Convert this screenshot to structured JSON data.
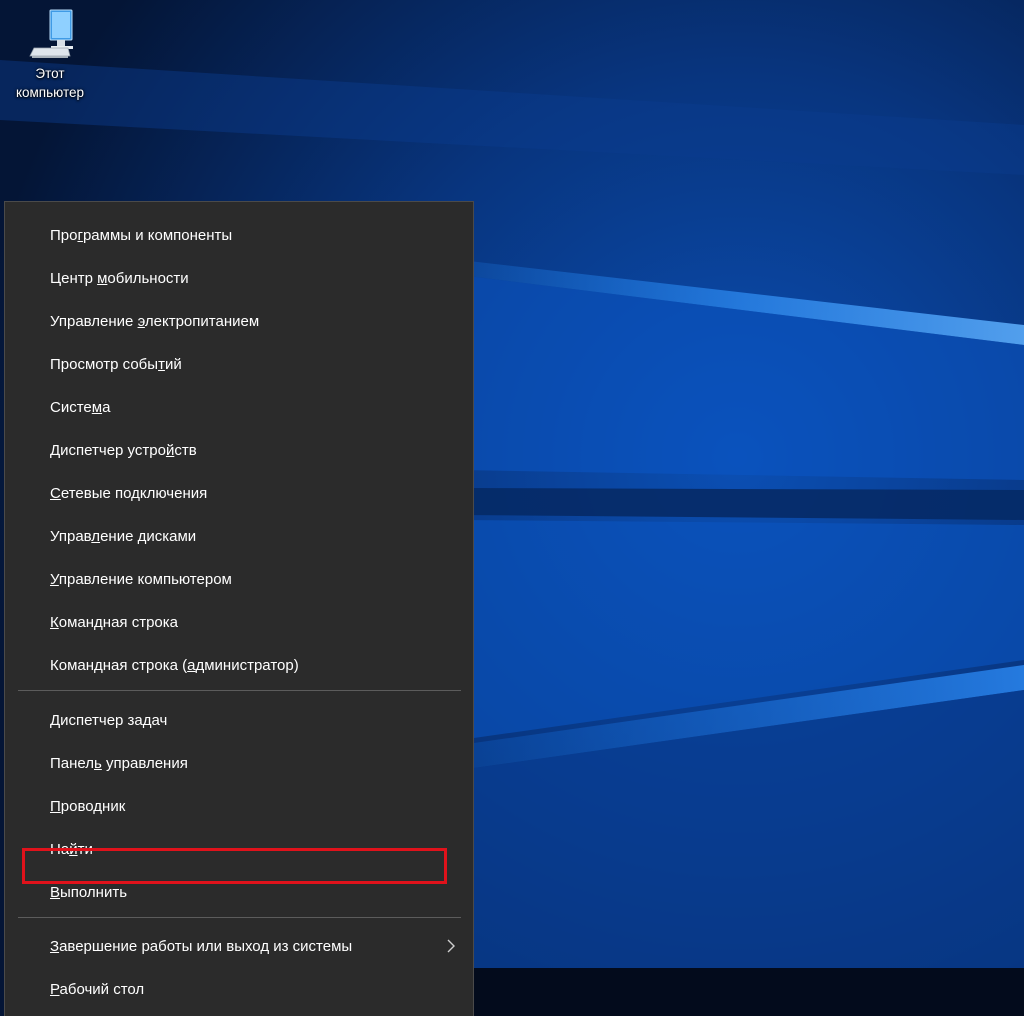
{
  "desktop": {
    "icons": [
      {
        "label_line1": "Этот",
        "label_line2": "компьютер",
        "icon": "computer-icon"
      }
    ]
  },
  "menu": {
    "items": [
      {
        "id": "programs-features",
        "pre": "Про",
        "ak": "г",
        "post": "раммы и компоненты"
      },
      {
        "id": "mobility-center",
        "pre": "Центр ",
        "ak": "м",
        "post": "обильности"
      },
      {
        "id": "power-options",
        "pre": "Управление ",
        "ak": "э",
        "post": "лектропитанием"
      },
      {
        "id": "event-viewer",
        "pre": "Просмотр собы",
        "ak": "т",
        "post": "ий"
      },
      {
        "id": "system",
        "pre": "Систе",
        "ak": "м",
        "post": "а"
      },
      {
        "id": "device-manager",
        "pre": "Диспетчер устро",
        "ak": "й",
        "post": "ств"
      },
      {
        "id": "network-connections",
        "pre": "",
        "ak": "С",
        "post": "етевые подключения"
      },
      {
        "id": "disk-management",
        "pre": "Управ",
        "ak": "л",
        "post": "ение дисками"
      },
      {
        "id": "computer-management",
        "pre": "",
        "ak": "У",
        "post": "правление компьютером"
      },
      {
        "id": "command-prompt",
        "pre": "",
        "ak": "К",
        "post": "омандная строка"
      },
      {
        "id": "command-prompt-admin",
        "pre": "Командная строка (",
        "ak": "а",
        "post": "дминистратор)"
      },
      {
        "id": "task-manager",
        "pre": "",
        "ak": "Д",
        "post": "испетчер задач"
      },
      {
        "id": "control-panel",
        "pre": "Панел",
        "ak": "ь",
        "post": " управления"
      },
      {
        "id": "file-explorer",
        "pre": "",
        "ak": "П",
        "post": "роводник"
      },
      {
        "id": "search",
        "pre": "На",
        "ak": "й",
        "post": "ти"
      },
      {
        "id": "run",
        "pre": "",
        "ak": "В",
        "post": "ыполнить"
      },
      {
        "id": "shutdown-signout",
        "pre": "",
        "ak": "З",
        "post": "авершение работы или выход из системы",
        "has_submenu": true
      },
      {
        "id": "desktop",
        "pre": "",
        "ak": "Р",
        "post": "абочий стол"
      }
    ],
    "highlighted_item": "command-prompt-admin",
    "highlight_color": "#e0121b"
  },
  "colors": {
    "menu_background": "#2b2b2b",
    "wallpaper_blue": "#0a58c9"
  }
}
